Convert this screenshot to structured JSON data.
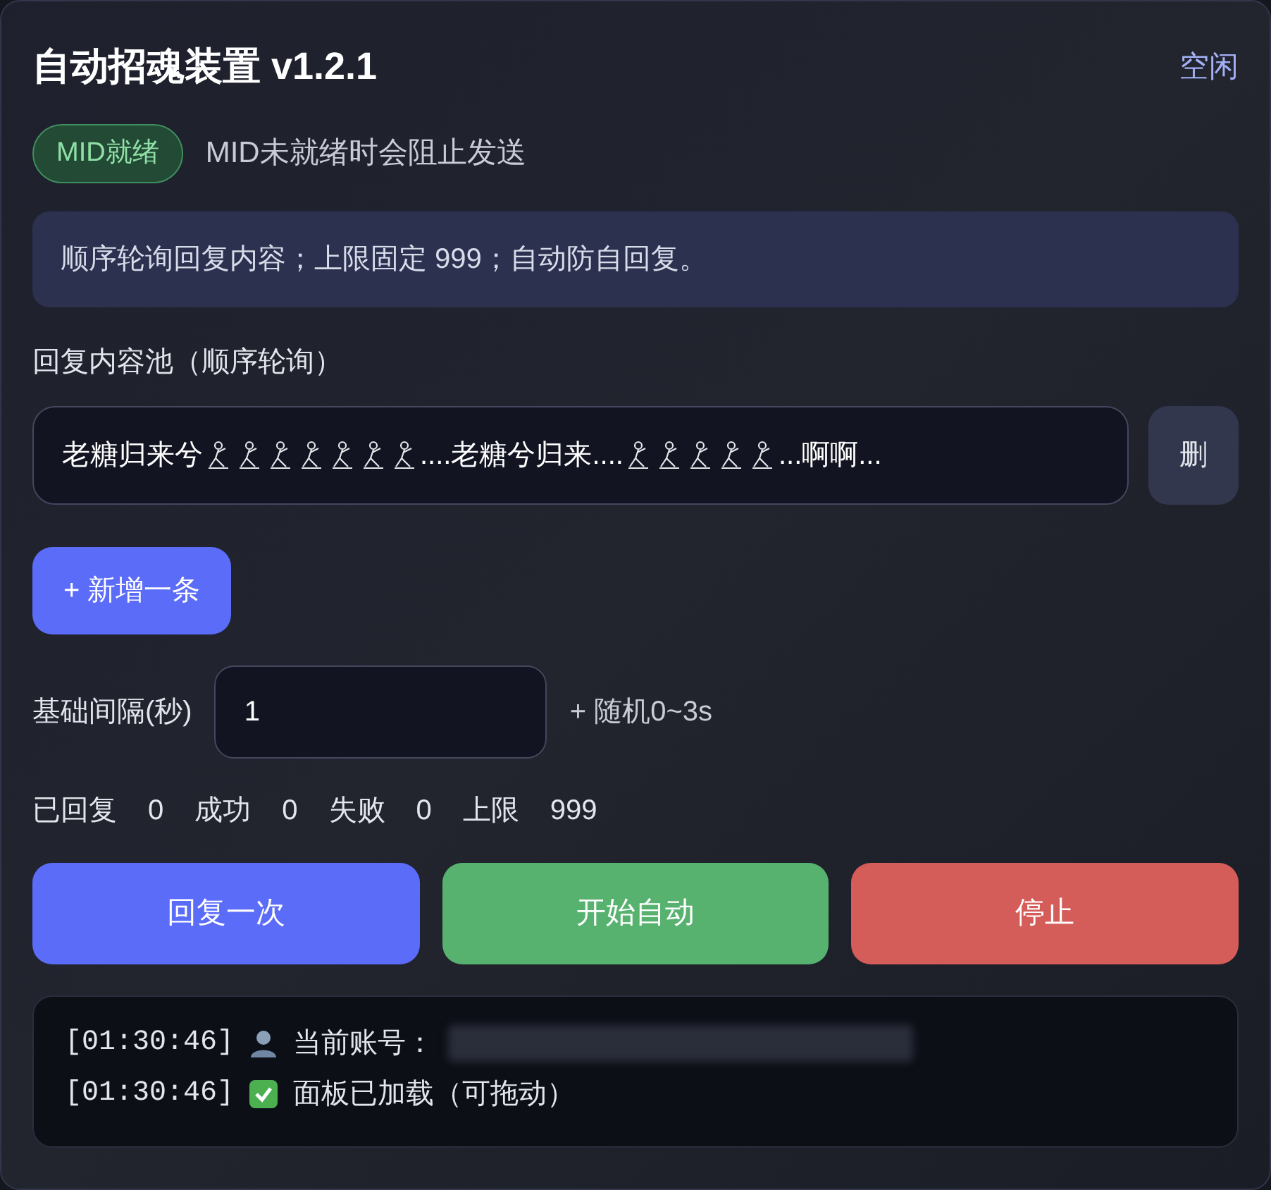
{
  "title": "自动招魂装置 v1.2.1",
  "status": "空闲",
  "mid": {
    "badge": "MID就绪",
    "ready": true,
    "note": "MID未就绪时会阻止发送"
  },
  "info": "顺序轮询回复内容；上限固定 999；自动防自回复。",
  "pool": {
    "label": "回复内容池（顺序轮询）",
    "items": [
      {
        "segments": [
          {
            "kind": "text",
            "text": "老糖归来兮"
          },
          {
            "kind": "figure"
          },
          {
            "kind": "figure"
          },
          {
            "kind": "figure"
          },
          {
            "kind": "figure"
          },
          {
            "kind": "figure"
          },
          {
            "kind": "figure"
          },
          {
            "kind": "figure"
          },
          {
            "kind": "text",
            "text": "....老糖兮归来...."
          },
          {
            "kind": "figure"
          },
          {
            "kind": "figure"
          },
          {
            "kind": "figure"
          },
          {
            "kind": "figure"
          },
          {
            "kind": "figure"
          },
          {
            "kind": "text",
            "text": "...啊啊..."
          }
        ],
        "delete": "删"
      }
    ],
    "add": "+ 新增一条"
  },
  "interval": {
    "label": "基础间隔(秒)",
    "value": "1",
    "suffix": "+ 随机0~3s"
  },
  "stats": [
    {
      "label": "已回复",
      "value": "0"
    },
    {
      "label": "成功",
      "value": "0"
    },
    {
      "label": "失败",
      "value": "0"
    },
    {
      "label": "上限",
      "value": "999"
    }
  ],
  "buttons": [
    {
      "label": "回复一次",
      "kind": "primary"
    },
    {
      "label": "开始自动",
      "kind": "success"
    },
    {
      "label": "停止",
      "kind": "danger"
    }
  ],
  "log": [
    {
      "time": "[01:30:46]",
      "kind": "user",
      "text": "当前账号：",
      "redacted": true
    },
    {
      "time": "[01:30:46]",
      "kind": "check",
      "text": "面板已加载（可拖动）",
      "redacted": false
    }
  ]
}
